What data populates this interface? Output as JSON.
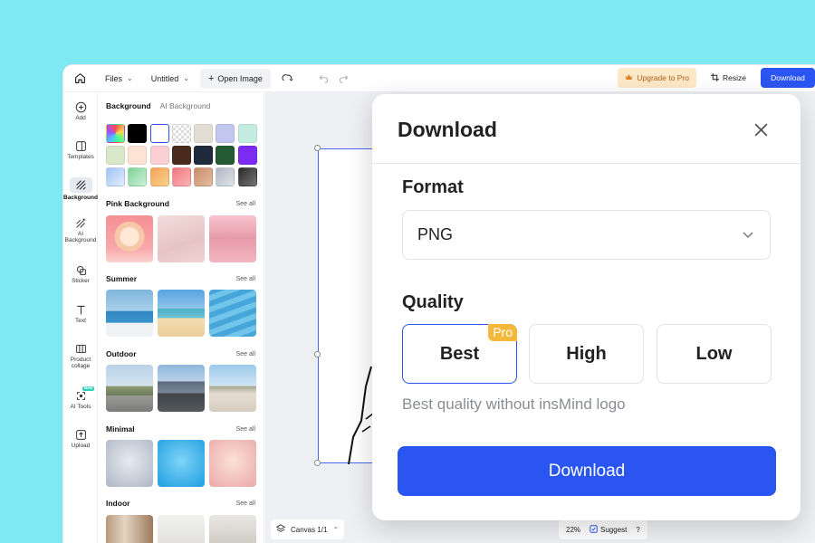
{
  "topbar": {
    "files_label": "Files",
    "doc_name": "Untitled",
    "open_image_label": "Open Image",
    "upgrade_label": "Upgrade to Pro",
    "resize_label": "Resize",
    "download_label": "Download"
  },
  "rail": {
    "items": [
      {
        "label": "Add",
        "icon": "plus-circle-icon"
      },
      {
        "label": "Templates",
        "icon": "templates-icon"
      },
      {
        "label": "Background",
        "icon": "background-icon",
        "active": true
      },
      {
        "label": "AI Background",
        "icon": "ai-background-icon"
      },
      {
        "label": "Sticker",
        "icon": "sticker-icon"
      },
      {
        "label": "Text",
        "icon": "text-icon"
      },
      {
        "label": "Product collage",
        "icon": "collage-icon"
      },
      {
        "label": "AI Tools",
        "icon": "ai-tools-icon",
        "badge": "New"
      },
      {
        "label": "Upload",
        "icon": "upload-icon"
      }
    ]
  },
  "panel": {
    "tab_active": "Background",
    "tab_other": "AI Background",
    "swatch_colors": [
      "gradient-rainbow",
      "#000000",
      "#ffffff",
      "transparent",
      "#e3ddd4",
      "#c3c7f0",
      "#c4ece0",
      "#d9e8c8",
      "#fde3d3",
      "#fad0d4",
      "#4a2a1c",
      "#1f2a3c",
      "#245a34",
      "#7b2cf0",
      "gradient-blue",
      "gradient-green",
      "gradient-orange",
      "gradient-red",
      "gradient-tan",
      "gradient-grey",
      "gradient-dark"
    ],
    "sections": [
      {
        "title": "Pink Background",
        "see_all": "See all"
      },
      {
        "title": "Summer",
        "see_all": "See all"
      },
      {
        "title": "Outdoor",
        "see_all": "See all"
      },
      {
        "title": "Minimal",
        "see_all": "See all"
      },
      {
        "title": "Indoor",
        "see_all": "See all"
      }
    ]
  },
  "canvas": {
    "pages_label": "Canvas 1/1",
    "zoom": "22%",
    "suggest_label": "Suggest",
    "help_label": "?"
  },
  "dialog": {
    "title": "Download",
    "format_label": "Format",
    "format_value": "PNG",
    "quality_label": "Quality",
    "quality_options": [
      {
        "label": "Best",
        "selected": true,
        "badge": "Pro"
      },
      {
        "label": "High"
      },
      {
        "label": "Low"
      }
    ],
    "quality_description": "Best quality without insMind logo",
    "download_button": "Download"
  },
  "colors": {
    "accent": "#2b55f0",
    "pro_badge": "#f4b93a",
    "page_background": "#7ee8f3"
  }
}
